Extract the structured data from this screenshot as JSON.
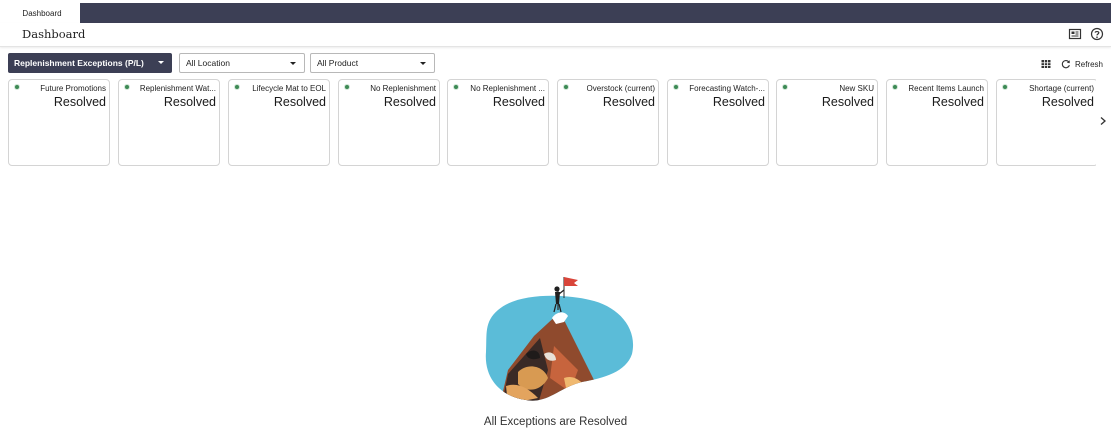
{
  "tabs": {
    "active_tab": "Dashboard"
  },
  "header": {
    "title": "Dashboard"
  },
  "filters": {
    "exception_type": "Replenishment Exceptions (P/L)",
    "location": "All Location",
    "product": "All Product"
  },
  "toolbar": {
    "refresh_label": "Refresh"
  },
  "cards": [
    {
      "name": "Future Promotions",
      "status": "Resolved"
    },
    {
      "name": "Replenishment Wat...",
      "status": "Resolved"
    },
    {
      "name": "Lifecycle Mat to EOL",
      "status": "Resolved"
    },
    {
      "name": "No Replenishment",
      "status": "Resolved"
    },
    {
      "name": "No Replenishment ...",
      "status": "Resolved"
    },
    {
      "name": "Overstock (current)",
      "status": "Resolved"
    },
    {
      "name": "Forecasting Watch-...",
      "status": "Resolved"
    },
    {
      "name": "New SKU",
      "status": "Resolved"
    },
    {
      "name": "Recent Items Launch",
      "status": "Resolved"
    },
    {
      "name": "Shortage (current)",
      "status": "Resolved"
    }
  ],
  "empty_state": {
    "message": "All Exceptions are Resolved"
  },
  "colors": {
    "nav": "#3c3f55",
    "status_dot": "#3d8a55",
    "card_border": "#d4d4d4"
  },
  "icons": [
    "report-icon",
    "help-icon",
    "grid-view-icon",
    "refresh-icon",
    "chevron-right-icon",
    "dropdown-caret-icon"
  ]
}
